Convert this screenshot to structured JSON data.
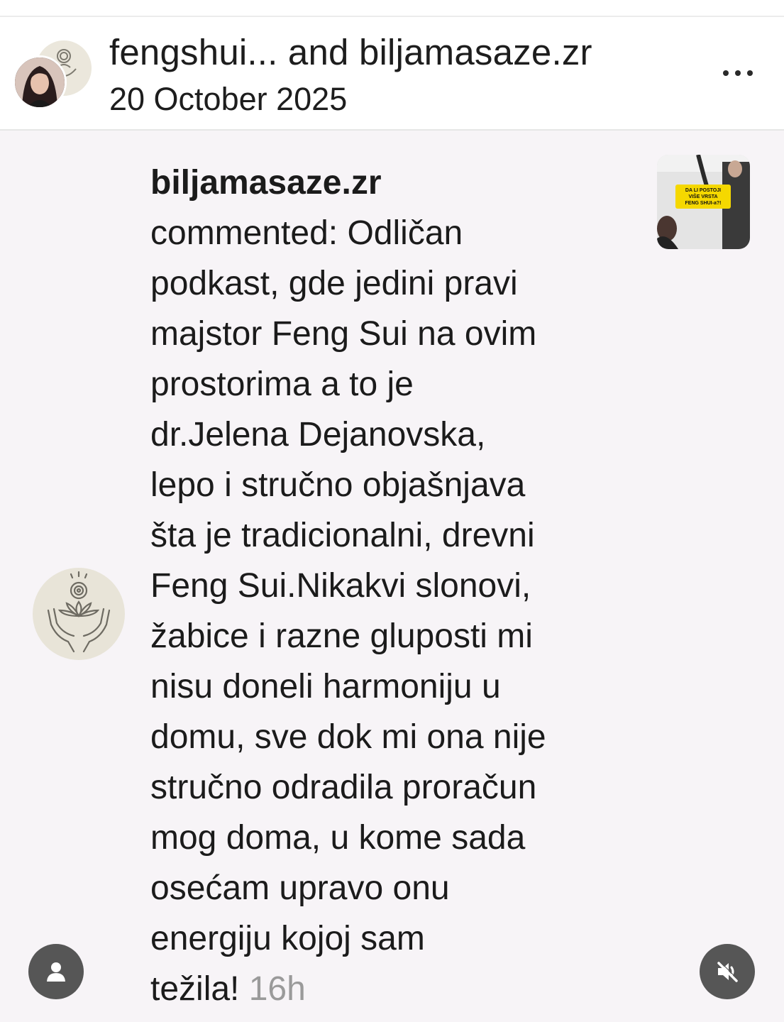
{
  "header": {
    "title": "fengshui... and biljamasaze.zr",
    "date": "20 October 2025",
    "more_icon": "more-horizontal-icon"
  },
  "notification": {
    "username": "biljamasaze.zr",
    "lines": [
      "commented: Odličan",
      "podkast, gde jedini pravi",
      "majstor Feng Sui na ovim",
      "prostorima a to je",
      "dr.Jelena Dejanovska,",
      "lepo i stručno objašnjava",
      "šta je tradicionalni, drevni",
      "Feng Sui.Nikakvi slonovi,",
      "žabice i razne gluposti mi",
      "nisu doneli harmoniju u",
      "domu, sve dok mi ona nije",
      "stručno odradila proračun",
      "mog doma, u kome sada",
      "osećam upravo onu",
      "energiju kojoj sam"
    ],
    "last_line": "težila!",
    "time": "16h",
    "thumbnail_text": [
      "DA LI POSTOJI",
      "VIŠE VRSTA",
      "FENG SHUI-a?!"
    ]
  },
  "controls": {
    "profile_icon": "person-icon",
    "mute_icon": "speaker-muted-icon"
  },
  "colors": {
    "background": "#f7f4f7",
    "time_gray": "#9a9a9a",
    "button_gray": "#565656",
    "thumbnail_yellow": "#f5d800"
  }
}
